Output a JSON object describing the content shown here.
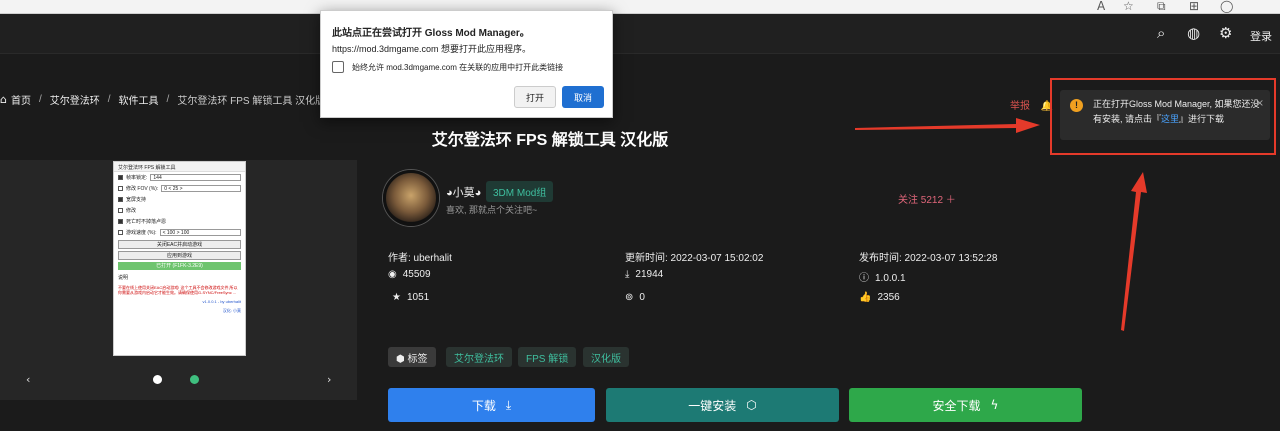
{
  "browser": {
    "icons": [
      "font-size-icon",
      "star-icon",
      "collections-icon",
      "extensions-icon",
      "profile-icon"
    ],
    "glyphs": [
      "A",
      "☆",
      "⧉",
      "⊞",
      "◯"
    ]
  },
  "header": {
    "icons": [
      "search-icon",
      "globe-icon",
      "gear-icon"
    ],
    "glyphs": [
      "⌕",
      "◍",
      "⚙"
    ],
    "login": "登录"
  },
  "breadcrumb": {
    "home": "首页",
    "game": "艾尔登法环",
    "category": "软件工具",
    "current": "艾尔登法环 FPS 解锁工具 汉化版",
    "separator": "/"
  },
  "report": {
    "label": "举报",
    "bell": "🔔"
  },
  "title": "艾尔登法环 FPS 解锁工具 汉化版",
  "gallery": {
    "prev": "‹",
    "next": "›",
    "window_title": "艾尔登法环 FPS 解锁工具",
    "rows": [
      {
        "label": "帧率锁定:",
        "value": "144",
        "checked": true
      },
      {
        "label": "修改 FOV (%):",
        "value": "0 < 25 >",
        "checked": false
      },
      {
        "label": "宽屏支持",
        "value": "",
        "checked": true
      },
      {
        "label": "修改",
        "value": "",
        "checked": false
      },
      {
        "label": "死亡时不掉落卢恩",
        "value": "",
        "checked": true
      },
      {
        "label": "游戏速度 (%):",
        "value": "< 100 > 100",
        "checked": false
      }
    ],
    "buttons": [
      "关闭EAC并启动游戏",
      "应用到游戏"
    ],
    "status": "已打开 (F1FK-3.2E9)",
    "note_title": "说明",
    "note_text": "不要在线上使用关闭EAC启动游戏! 这个工具不会修改游戏文件,所以你需要从游戏内启动它才能生效。请确保使用G-SYNC/FreeSync ...",
    "footer_link": "v1.0.0.1 - by uberhalit",
    "footer_link2": "汉化: 小莫"
  },
  "author": {
    "name": "◕小莫◕",
    "badge": "3DM Mod组",
    "motto": "喜欢, 那就点个关注吧~",
    "follow": "关注 5212 ＋"
  },
  "meta": {
    "author_label": "作者: uberhalit",
    "updated": "更新时间: 2022-03-07 15:02:02",
    "published": "发布时间: 2022-03-07 13:52:28",
    "views": "45509",
    "downloads": "21944",
    "version": "1.0.0.1",
    "favorites": "1051",
    "zero": "0",
    "likes": "2356"
  },
  "tags": {
    "label": "标签",
    "items": [
      "艾尔登法环",
      "FPS 解锁",
      "汉化版"
    ]
  },
  "actions": {
    "download": "下载",
    "install": "一键安装",
    "safe": "安全下载",
    "download_color": "#2f80ed",
    "install_color": "#1d7a74",
    "safe_color": "#2ea84a"
  },
  "dialog": {
    "title": "此站点正在尝试打开 Gloss Mod Manager。",
    "message": "https://mod.3dmgame.com 想要打开此应用程序。",
    "checkbox": "始终允许 mod.3dmgame.com 在关联的应用中打开此类链接",
    "open": "打开",
    "cancel": "取消"
  },
  "toast": {
    "text_before": "正在打开Gloss Mod Manager, 如果您还没有安装, 请点击『",
    "link": "这里",
    "text_after": "』进行下载",
    "close": "×"
  },
  "annotation_color": "#e53a2a"
}
